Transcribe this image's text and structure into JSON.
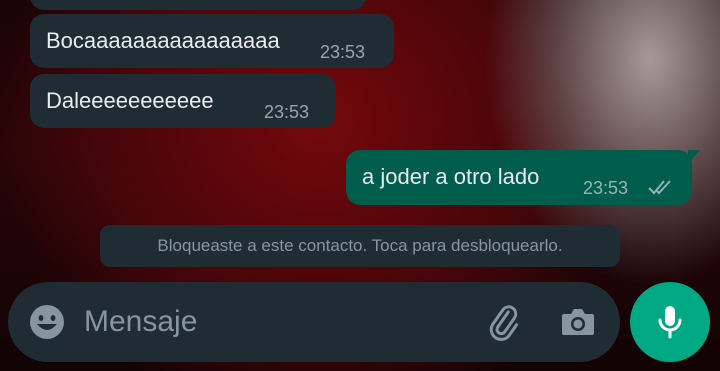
{
  "messages": [
    {
      "direction": "in",
      "text": "",
      "time": ""
    },
    {
      "direction": "in",
      "text": "Bocaaaaaaaaaaaaaaaa",
      "time": "23:53"
    },
    {
      "direction": "in",
      "text": "Daleeeeeeeeeee",
      "time": "23:53"
    },
    {
      "direction": "out",
      "text": "a joder a otro lado",
      "time": "23:53",
      "status": "read-double-check-icon"
    }
  ],
  "system_note": "Bloqueaste a este contacto. Toca para desbloquearlo.",
  "composer": {
    "placeholder": "Mensaje",
    "value": "",
    "icons": [
      "emoji-icon",
      "attach-icon",
      "camera-icon",
      "microphone-icon"
    ]
  },
  "colors": {
    "incoming_bubble": "#1f2c33",
    "outgoing_bubble": "#005c4b",
    "accent": "#00a884",
    "muted_text": "#8696a0"
  }
}
